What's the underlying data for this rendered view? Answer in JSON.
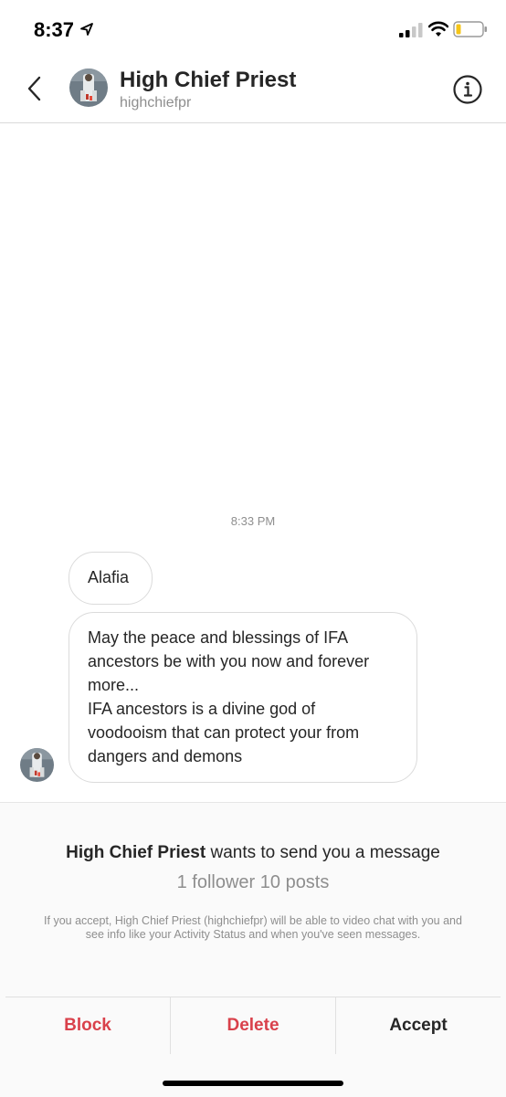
{
  "status_bar": {
    "time": "8:37",
    "icons": [
      "location-arrow-icon",
      "cellular-signal-icon",
      "wifi-icon",
      "battery-icon"
    ],
    "battery_color": "#f5c518"
  },
  "header": {
    "title": "High Chief Priest",
    "username": "highchiefpr",
    "back_icon": "chevron-left-icon",
    "info_icon": "info-icon"
  },
  "conversation": {
    "timestamp": "8:33 PM",
    "messages": [
      {
        "paragraphs": [
          "Alafia"
        ]
      },
      {
        "paragraphs": [
          "May the peace and blessings of IFA ancestors be with you now and forever more...",
          "IFA ancestors is a divine god of voodooism that can protect your from dangers and demons"
        ]
      }
    ]
  },
  "request": {
    "sender_name": "High Chief Priest",
    "title_suffix": " wants to send you a message",
    "stats": "1 follower 10 posts",
    "note": "If you accept, High Chief Priest (highchiefpr) will be able to video chat with you and see info like your Activity Status and when you've seen messages.",
    "actions": {
      "block": "Block",
      "delete": "Delete",
      "accept": "Accept"
    }
  },
  "colors": {
    "destructive": "#d9414b",
    "text": "#262626",
    "muted": "#8e8e8e"
  }
}
